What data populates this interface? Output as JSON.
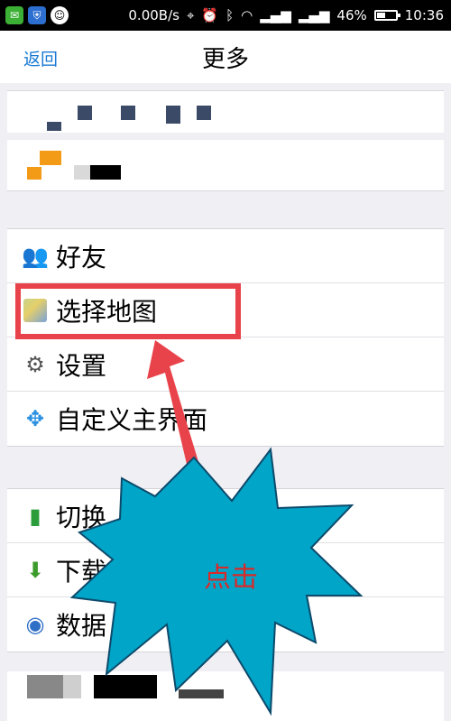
{
  "status_bar": {
    "net_speed": "0.00B/s",
    "battery_percent": "46%",
    "battery_level": 0.46,
    "time": "10:36",
    "left_icons": [
      "wechat-icon",
      "shield-icon",
      "qq-icon"
    ],
    "right_icons": [
      "location-icon",
      "alarm-icon",
      "bluetooth-icon",
      "wifi-icon",
      "signal-icon",
      "signal-icon",
      "battery-icon"
    ]
  },
  "nav": {
    "back_label": "返回",
    "title": "更多"
  },
  "menu_group_1": [
    {
      "label": "好友",
      "icon": "friends-icon"
    },
    {
      "label": "选择地图",
      "icon": "map-icon"
    },
    {
      "label": "设置",
      "icon": "gear-icon"
    },
    {
      "label": "自定义主界面",
      "icon": "compass-icon"
    }
  ],
  "menu_group_2": [
    {
      "label": "切换",
      "icon": "bar-chart-icon"
    },
    {
      "label": "下载",
      "icon": "download-icon"
    },
    {
      "label": "数据",
      "icon": "globe-icon"
    }
  ],
  "annotation": {
    "callout_text": "点击"
  },
  "colors": {
    "accent_blue": "#1a79d4",
    "highlight_red": "#e8434a",
    "callout_fill": "#00a5c8",
    "callout_text": "#d92a2a"
  }
}
